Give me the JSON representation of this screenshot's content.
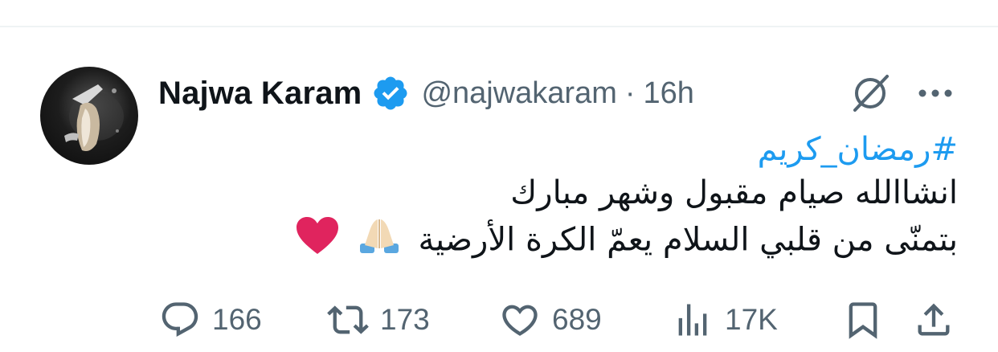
{
  "author": {
    "display_name": "Najwa Karam",
    "handle": "@najwakaram",
    "separator": "·",
    "time": "16h",
    "verified_icon": "verified-badge-icon",
    "accent_color": "#1d9bf0"
  },
  "tweet": {
    "hashtag": "#رمضان_كريم",
    "line1": "انشاالله صيام مقبول وشهر مبارك",
    "line2": "بتمنّى من قلبي السلام يعمّ الكرة الأرضية"
  },
  "actions": {
    "replies": "166",
    "retweets": "173",
    "likes": "689",
    "views": "17K"
  },
  "colors": {
    "text": "#0f1419",
    "secondary": "#536471",
    "link": "#1d9bf0",
    "heart": "#e0245e"
  }
}
